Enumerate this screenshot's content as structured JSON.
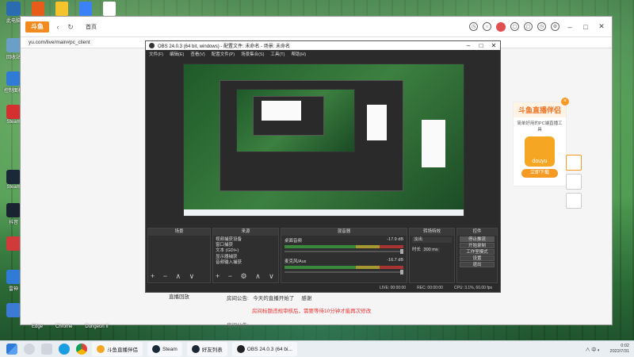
{
  "desktop": {
    "left_icons": [
      {
        "label": "此电脑",
        "color": "#2b6cb0"
      },
      {
        "label": "回收站",
        "color": "#6aa0c8"
      },
      {
        "label": "控制面板",
        "color": "#2f7bd6"
      },
      {
        "label": "Steam",
        "color": "#d43030"
      },
      {
        "label": "Steam",
        "color": "#1b2838"
      },
      {
        "label": "抖音",
        "color": "#1a2430"
      },
      {
        "label": "",
        "color": "#d03a3a"
      },
      {
        "label": "雷神",
        "color": "#2f7bd6"
      },
      {
        "label": "",
        "color": "#3b7bd6"
      }
    ],
    "top_icons": [
      "#e85c1a",
      "#f5c32b",
      "#3b82f6",
      "#ffffff"
    ],
    "bottom_names": [
      "Edge",
      "Chrome",
      "Dungeon II"
    ]
  },
  "browser": {
    "tab_label": "首页",
    "url": "yu.com/live/main#pc_client",
    "notice": {
      "label": "房间公告:",
      "highlight": "今天的直播开始了",
      "rest": "感谢",
      "warn": "房间标题违规审核后，需要等待10分钟才能再次修改",
      "label2": "房间公告:"
    },
    "under_text": "直播回放",
    "ad": {
      "title": "斗鱼直播伴侣",
      "subtitle": "简单好用的PC端直播工具",
      "button": "立即下载",
      "close": "×"
    }
  },
  "obs": {
    "title": "OBS 24.0.3 (64 bit, windows) - 配置文件: 未命名 - 场景: 未命名",
    "menu": [
      "文件(F)",
      "编辑(E)",
      "查看(V)",
      "配置文件(P)",
      "场景集合(S)",
      "工具(T)",
      "帮助(H)"
    ],
    "docks": {
      "scenes": {
        "title": "场景",
        "items": []
      },
      "sources": {
        "title": "来源",
        "items": [
          "视频捕获设备",
          "窗口捕获",
          "文本 (GDI+)",
          "显示器捕获",
          "音频输入捕获"
        ]
      },
      "mixer": {
        "title": "混音器",
        "channels": [
          {
            "name": "桌面音频",
            "db": "-17.9 dB"
          },
          {
            "name": "麦克风/Aux",
            "db": "-16.7 dB"
          }
        ]
      },
      "transitions": {
        "title": "转场特效",
        "type": "淡出",
        "duration_label": "时长",
        "duration": "300 ms"
      },
      "controls": {
        "title": "控件",
        "buttons": [
          "停止推流",
          "开始录制",
          "工作室模式",
          "设置",
          "退出"
        ]
      }
    },
    "status": {
      "live": "LIVE: 00:00:00",
      "rec": "REC: 00:00:00",
      "cpu": "CPU: 3.1%, 60.00 fps"
    }
  },
  "taskbar": {
    "items": [
      {
        "label": "斗鱼直播伴侣",
        "color": "#f5a623"
      },
      {
        "label": "Steam",
        "color": "#1b2838"
      },
      {
        "label": "好友列表",
        "color": "#1b2838"
      },
      {
        "label": "OBS 24.0.3 (64 bi...",
        "color": "#222"
      }
    ],
    "tray": "∧ 中 ◐",
    "time": "0:02",
    "date": "2022/7/31"
  }
}
